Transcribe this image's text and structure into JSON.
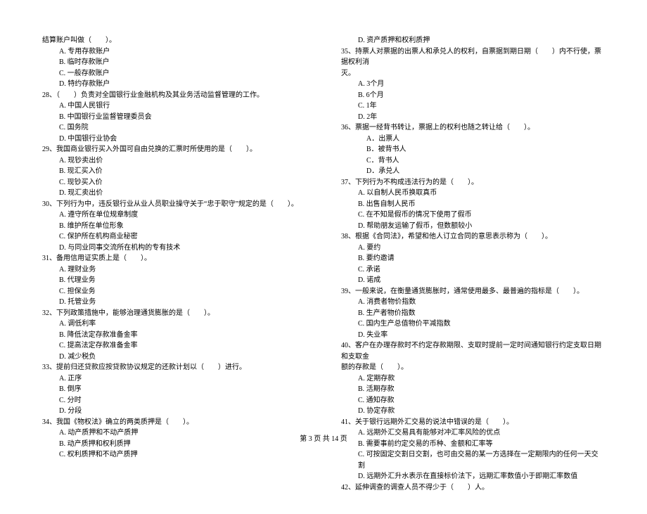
{
  "footer": "第 3 页 共 14 页",
  "left": [
    {
      "cls": "qline",
      "t": "结算账户叫做（　　）。"
    },
    {
      "cls": "opt",
      "t": "A. 专用存款账户"
    },
    {
      "cls": "opt",
      "t": "B. 临时存款账户"
    },
    {
      "cls": "opt",
      "t": "C. 一般存款账户"
    },
    {
      "cls": "opt",
      "t": "D. 特约存款账户"
    },
    {
      "cls": "qline",
      "t": "28、（　　）负责对全国银行业金融机构及其业务活动监督管理的工作。"
    },
    {
      "cls": "opt",
      "t": "A. 中国人民银行"
    },
    {
      "cls": "opt",
      "t": "B. 中国银行业监督管理委员会"
    },
    {
      "cls": "opt",
      "t": "C. 国务院"
    },
    {
      "cls": "opt",
      "t": "D. 中国银行业协会"
    },
    {
      "cls": "qline",
      "t": "29、我国商业银行买入外国可自由兑换的汇票时所使用的是（　　）。"
    },
    {
      "cls": "opt",
      "t": "A. 现钞卖出价"
    },
    {
      "cls": "opt",
      "t": "B. 现汇买入价"
    },
    {
      "cls": "opt",
      "t": "C. 现钞买入价"
    },
    {
      "cls": "opt",
      "t": "D. 现汇卖出价"
    },
    {
      "cls": "qline",
      "t": "30、下列行为中，违反银行业从业人员职业操守关于“忠于职守”规定的是（　　）。"
    },
    {
      "cls": "opt",
      "t": "A. 遵守所在单位规章制度"
    },
    {
      "cls": "opt",
      "t": "B. 维护所在单位形象"
    },
    {
      "cls": "opt",
      "t": "C. 保护所在机构商业秘密"
    },
    {
      "cls": "opt",
      "t": "D. 与同业同事交流所在机构的专有技术"
    },
    {
      "cls": "qline",
      "t": "31、备用信用证实质上是（　　）。"
    },
    {
      "cls": "opt",
      "t": "A. 理财业务"
    },
    {
      "cls": "opt",
      "t": "B. 代理业务"
    },
    {
      "cls": "opt",
      "t": "C. 担保业务"
    },
    {
      "cls": "opt",
      "t": "D. 托管业务"
    },
    {
      "cls": "qline",
      "t": "32、下列政策措施中，能够治理通货膨胀的是（　　）。"
    },
    {
      "cls": "opt",
      "t": "A. 调低利率"
    },
    {
      "cls": "opt",
      "t": "B. 降低法定存款准备金率"
    },
    {
      "cls": "opt",
      "t": "C. 提高法定存款准备金率"
    },
    {
      "cls": "opt",
      "t": "D. 减少税负"
    },
    {
      "cls": "qline",
      "t": "33、提前归还贷款应按贷款协议规定的还款计划以（　　）进行。"
    },
    {
      "cls": "opt",
      "t": "A. 正序"
    },
    {
      "cls": "opt",
      "t": "B. 倒序"
    },
    {
      "cls": "opt",
      "t": "C. 分时"
    },
    {
      "cls": "opt",
      "t": "D. 分段"
    },
    {
      "cls": "qline",
      "t": "34、我国《物权法》确立的两类质押是（　　）。"
    },
    {
      "cls": "opt",
      "t": "A. 动产质押和不动产质押"
    },
    {
      "cls": "opt",
      "t": "B. 动产质押和权利质押"
    },
    {
      "cls": "opt",
      "t": "C. 权利质押和不动产质押"
    }
  ],
  "right": [
    {
      "cls": "opt",
      "t": "D. 资产质押和权利质押"
    },
    {
      "cls": "qline",
      "t": "35、持票人对票据的出票人和承兑人的权利，自票据到期日期（　　）内不行使，票据权利消"
    },
    {
      "cls": "qline",
      "t": "灭。"
    },
    {
      "cls": "opt",
      "t": "A. 3个月"
    },
    {
      "cls": "opt",
      "t": "B. 6个月"
    },
    {
      "cls": "opt",
      "t": "C. 1年"
    },
    {
      "cls": "opt",
      "t": "D. 2年"
    },
    {
      "cls": "qline",
      "t": "36、票据一经背书转让，票据上的权利也随之转让给（　　）。"
    },
    {
      "cls": "opt-indent",
      "t": "A．出票人"
    },
    {
      "cls": "opt-indent",
      "t": "B．被背书人"
    },
    {
      "cls": "opt-indent",
      "t": "C．背书人"
    },
    {
      "cls": "opt-indent",
      "t": "D．承兑人"
    },
    {
      "cls": "qline",
      "t": "37、下列行为不构成违法行为的是（　　）。"
    },
    {
      "cls": "opt",
      "t": "A. 以自制人民币换取真币"
    },
    {
      "cls": "opt",
      "t": "B. 出售自制人民币"
    },
    {
      "cls": "opt",
      "t": "C. 在不知是假币的情况下使用了假币"
    },
    {
      "cls": "opt",
      "t": "D. 帮助朋友运输了假币，但数额较小"
    },
    {
      "cls": "qline",
      "t": "38、根据《合同法》，希望和他人订立合同的意思表示称为（　　）。"
    },
    {
      "cls": "opt",
      "t": "A. 要约"
    },
    {
      "cls": "opt",
      "t": "B. 要约邀请"
    },
    {
      "cls": "opt",
      "t": "C. 承诺"
    },
    {
      "cls": "opt",
      "t": "D. 诺成"
    },
    {
      "cls": "qline",
      "t": "39、一般来说，在衡量通货膨胀时，通常使用最多、最普遍的指标是（　　）。"
    },
    {
      "cls": "opt",
      "t": "A. 消费者物价指数"
    },
    {
      "cls": "opt",
      "t": "B. 生产者物价指数"
    },
    {
      "cls": "opt",
      "t": "C. 国内生产总值物价平减指数"
    },
    {
      "cls": "opt",
      "t": "D. 失业率"
    },
    {
      "cls": "qline",
      "t": "40、客户在办理存款时不约定存款期限、支取时提前一定时间通知银行约定支取日期和支取金"
    },
    {
      "cls": "qline",
      "t": "额的存款是（　　）。"
    },
    {
      "cls": "opt",
      "t": "A. 定期存款"
    },
    {
      "cls": "opt",
      "t": "B. 活期存款"
    },
    {
      "cls": "opt",
      "t": "C. 通知存款"
    },
    {
      "cls": "opt",
      "t": "D. 协定存款"
    },
    {
      "cls": "qline",
      "t": "41、关于银行远期外汇交易的说法中错误的是（　　）。"
    },
    {
      "cls": "opt",
      "t": "A. 远期外汇交易具有能够对冲汇率风险的优点"
    },
    {
      "cls": "opt",
      "t": "B. 需要事前约定交易的币种、金额和汇率等"
    },
    {
      "cls": "opt",
      "t": "C. 可按固定交割日交割，也可由交易的某一方选择在一定期限内的任何一天交割"
    },
    {
      "cls": "opt",
      "t": "D. 远期外汇升水表示在直接标价法下，远期汇率数值小于即期汇率数值"
    },
    {
      "cls": "qline",
      "t": "42、延伸调查的调查人员不得少于（　　）人。"
    }
  ]
}
